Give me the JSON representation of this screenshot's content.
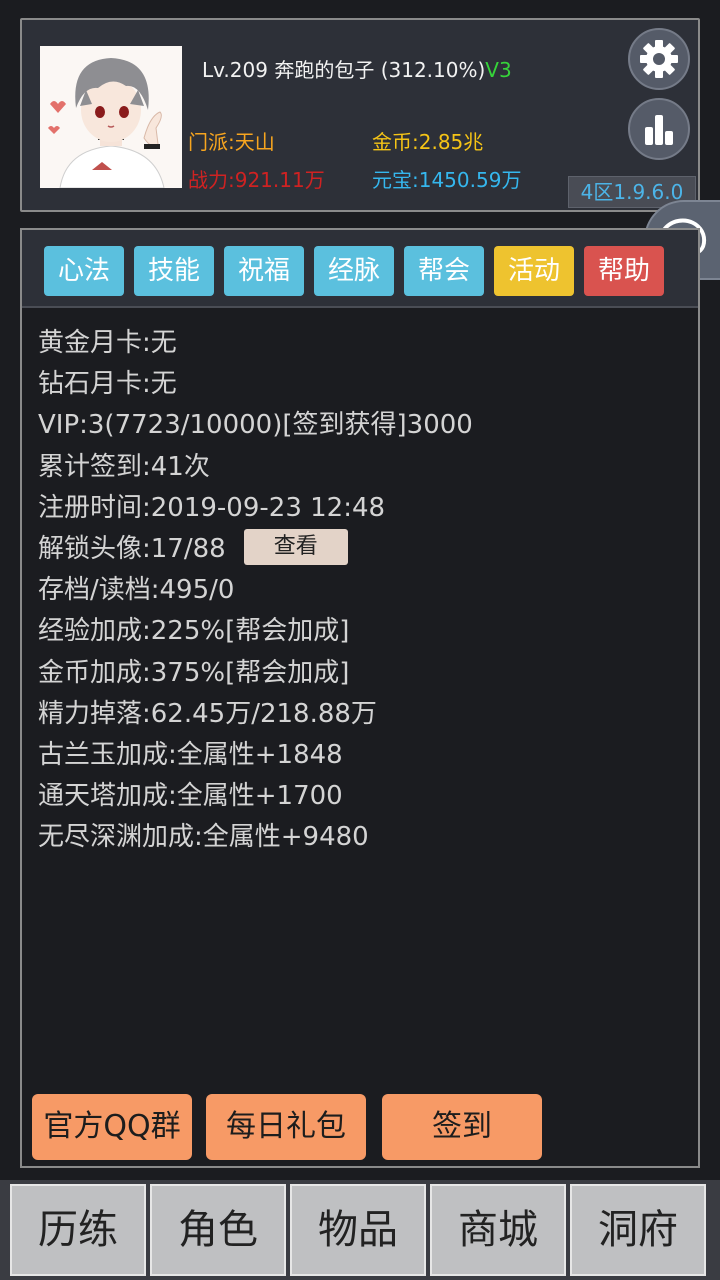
{
  "player": {
    "level": "Lv.209",
    "name": "奔跑的包子",
    "exp_percent": "(312.10%)",
    "vip_tag": "V3",
    "sect": "门派:天山",
    "gold": "金币:2.85兆",
    "power": "战力:921.11万",
    "yuanbao": "元宝:1450.59万",
    "server": "4区1.9.6.0"
  },
  "icons": {
    "settings": "gear-icon",
    "stats": "bar-chart-icon",
    "contact": "at-icon"
  },
  "at_symbol": "@",
  "tabs": [
    {
      "label": "心法",
      "color": "#5bc0de"
    },
    {
      "label": "技能",
      "color": "#5bc0de"
    },
    {
      "label": "祝福",
      "color": "#5bc0de"
    },
    {
      "label": "经脉",
      "color": "#5bc0de"
    },
    {
      "label": "帮会",
      "color": "#5bc0de"
    },
    {
      "label": "活动",
      "color": "#eec32f"
    },
    {
      "label": "帮助",
      "color": "#d9534f"
    }
  ],
  "info": [
    "黄金月卡:无",
    "钻石月卡:无",
    "VIP:3(7723/10000)[签到获得]3000",
    "累计签到:41次",
    "注册时间:2019-09-23 12:48",
    "解锁头像:17/88",
    "存档/读档:495/0",
    "经验加成:225%[帮会加成]",
    "金币加成:375%[帮会加成]",
    "精力掉落:62.45万/218.88万",
    "古兰玉加成:全属性+1848",
    "通天塔加成:全属性+1700",
    "无尽深渊加成:全属性+9480"
  ],
  "view_button": "查看",
  "actions": {
    "qq_group": "官方QQ群",
    "daily_gift": "每日礼包",
    "sign_in": "签到"
  },
  "nav": [
    "历练",
    "角色",
    "物品",
    "商城",
    "洞府"
  ],
  "colors": {
    "background": "#1b1c20",
    "panel": "#2d3038",
    "action": "#f79a66",
    "vip": "#36d33a",
    "gold": "#f5c416",
    "power": "#cf2222",
    "yuanbao": "#35b7ee"
  }
}
